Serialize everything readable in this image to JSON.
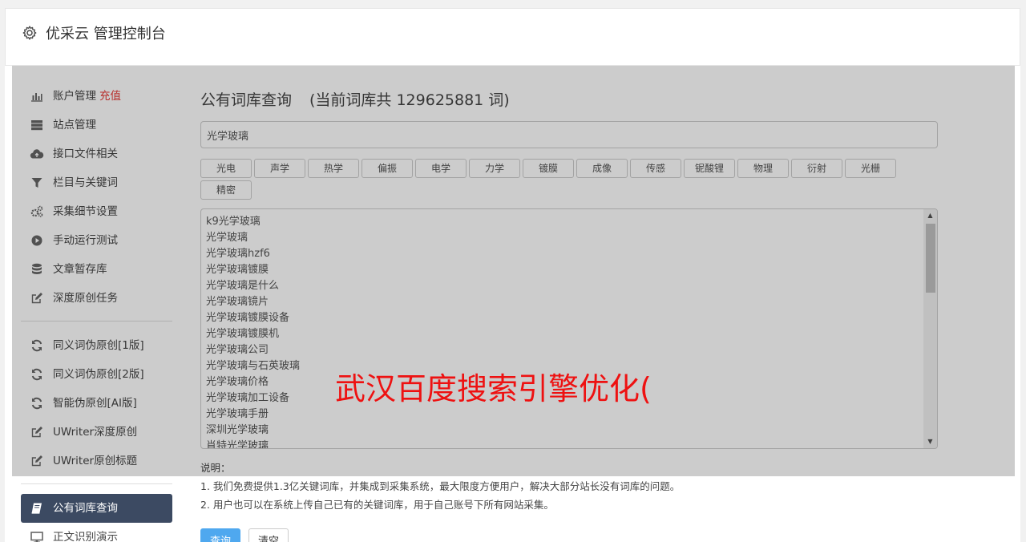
{
  "header": {
    "icon": "gear-icon",
    "title": "优采云 管理控制台"
  },
  "sidebar": {
    "group1": [
      {
        "name": "sidebar-item-account",
        "icon": "bar-chart-icon",
        "label": "账户管理",
        "badge": "充值"
      },
      {
        "name": "sidebar-item-sites",
        "icon": "server-icon",
        "label": "站点管理"
      },
      {
        "name": "sidebar-item-api-files",
        "icon": "cloud-upload-icon",
        "label": "接口文件相关"
      },
      {
        "name": "sidebar-item-columns-keywords",
        "icon": "filter-icon",
        "label": "栏目与关键词"
      },
      {
        "name": "sidebar-item-collect-settings",
        "icon": "cogs-icon",
        "label": "采集细节设置"
      },
      {
        "name": "sidebar-item-manual-run",
        "icon": "play-circle-icon",
        "label": "手动运行测试"
      },
      {
        "name": "sidebar-item-article-store",
        "icon": "database-icon",
        "label": "文章暂存库"
      },
      {
        "name": "sidebar-item-deep-original",
        "icon": "edit-icon",
        "label": "深度原创任务"
      }
    ],
    "group2": [
      {
        "name": "sidebar-item-synonym-v1",
        "icon": "refresh-icon",
        "label": "同义词伪原创[1版]"
      },
      {
        "name": "sidebar-item-synonym-v2",
        "icon": "refresh-icon",
        "label": "同义词伪原创[2版]"
      },
      {
        "name": "sidebar-item-ai-rewrite",
        "icon": "refresh-icon",
        "label": "智能伪原创[AI版]"
      },
      {
        "name": "sidebar-item-uwriter-deep",
        "icon": "edit-icon",
        "label": "UWriter深度原创"
      },
      {
        "name": "sidebar-item-uwriter-title",
        "icon": "edit-icon",
        "label": "UWriter原创标题"
      }
    ],
    "group3": [
      {
        "name": "sidebar-item-public-lexicon",
        "icon": "book-icon",
        "label": "公有词库查询",
        "active": true
      },
      {
        "name": "sidebar-item-text-recognition",
        "icon": "monitor-icon",
        "label": "正文识别演示"
      }
    ]
  },
  "main": {
    "title": "公有词库查询",
    "count_text": "(当前词库共 129625881 词)",
    "search_value": "光学玻璃",
    "tags": [
      "光电",
      "声学",
      "热学",
      "偏振",
      "电学",
      "力学",
      "镀膜",
      "成像",
      "传感",
      "铌酸锂",
      "物理",
      "衍射",
      "光栅",
      "精密"
    ],
    "results": [
      "k9光学玻璃",
      "光学玻璃",
      "光学玻璃hzf6",
      "光学玻璃镀膜",
      "光学玻璃是什么",
      "光学玻璃镜片",
      "光学玻璃镀膜设备",
      "光学玻璃镀膜机",
      "光学玻璃公司",
      "光学玻璃与石英玻璃",
      "光学玻璃价格",
      "光学玻璃加工设备",
      "光学玻璃手册",
      "深圳光学玻璃",
      "肖特光学玻璃"
    ],
    "notes_title": "说明：",
    "notes": [
      "1. 我们免费提供1.3亿关键词库，并集成到采集系统，最大限度方便用户，解决大部分站长没有词库的问题。",
      "2. 用户也可以在系统上传自己已有的关键词库，用于自己账号下所有网站采集。"
    ],
    "query_button": "查询",
    "clear_button": "清空"
  },
  "watermark": "武汉百度搜索引擎优化(",
  "colors": {
    "active_bg": "#3c4a62",
    "primary": "#4fa8ef",
    "badge": "#e53935",
    "watermark": "#ee1111"
  }
}
